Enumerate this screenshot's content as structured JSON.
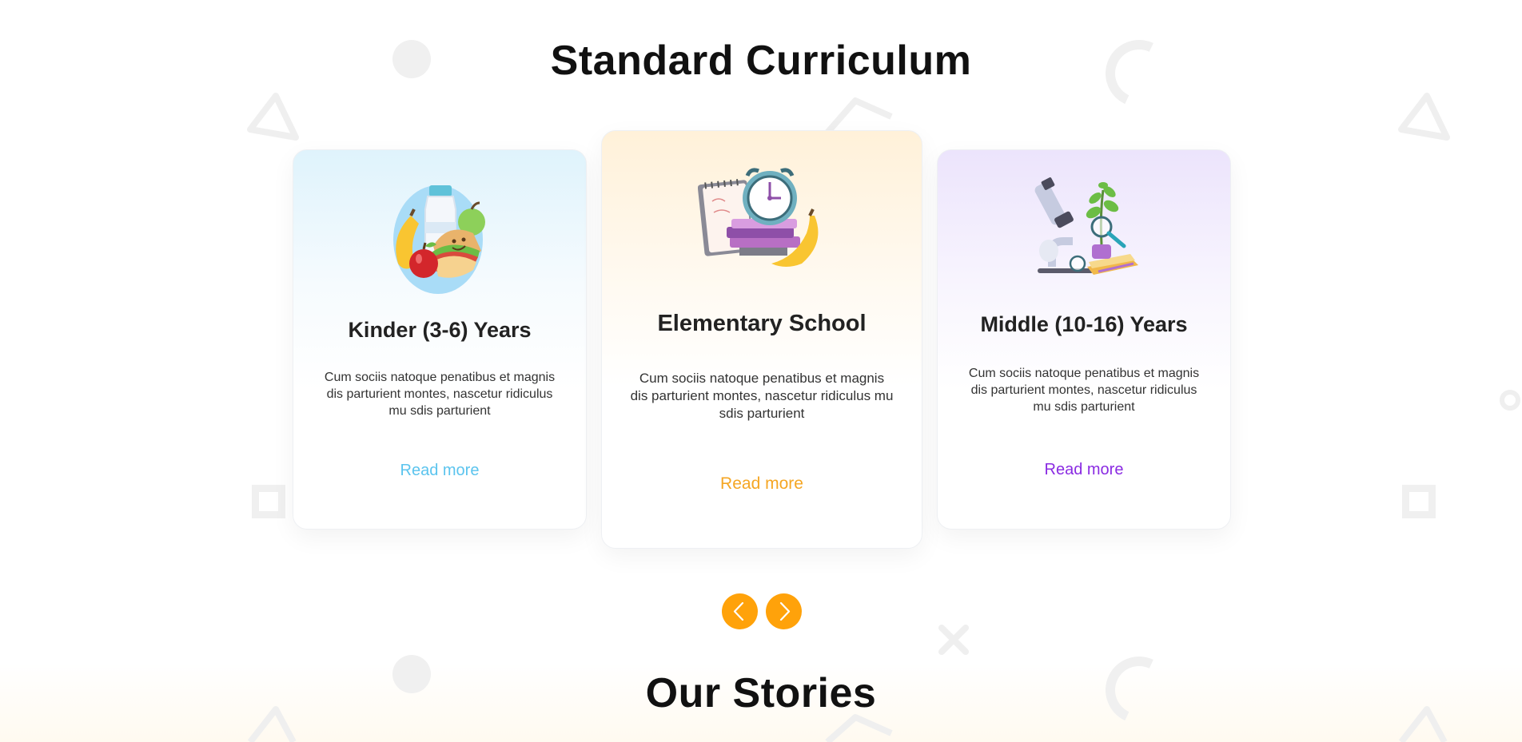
{
  "section": {
    "title": "Standard Curriculum"
  },
  "cards": [
    {
      "title": "Kinder (3-6) Years",
      "description": "Cum sociis natoque penatibus et magnis dis parturient montes, nascetur ridiculus mu sdis parturient",
      "link": "Read more",
      "accent": "#5bc4ee",
      "icon": "lunch-food-illustration"
    },
    {
      "title": "Elementary School",
      "description": "Cum sociis natoque penatibus et magnis dis parturient montes, nascetur ridiculus mu sdis parturient",
      "link": "Read more",
      "accent": "#f5a623",
      "icon": "alarm-clock-books-illustration"
    },
    {
      "title": "Middle (10-16) Years",
      "description": "Cum sociis natoque penatibus et magnis dis parturient montes, nascetur ridiculus mu sdis parturient",
      "link": "Read more",
      "accent": "#8a2be2",
      "icon": "microscope-science-illustration"
    }
  ],
  "carousel": {
    "button_color": "#ffa20a",
    "prev_icon": "chevron-left-icon",
    "next_icon": "chevron-right-icon"
  },
  "next_section": {
    "title": "Our Stories"
  }
}
